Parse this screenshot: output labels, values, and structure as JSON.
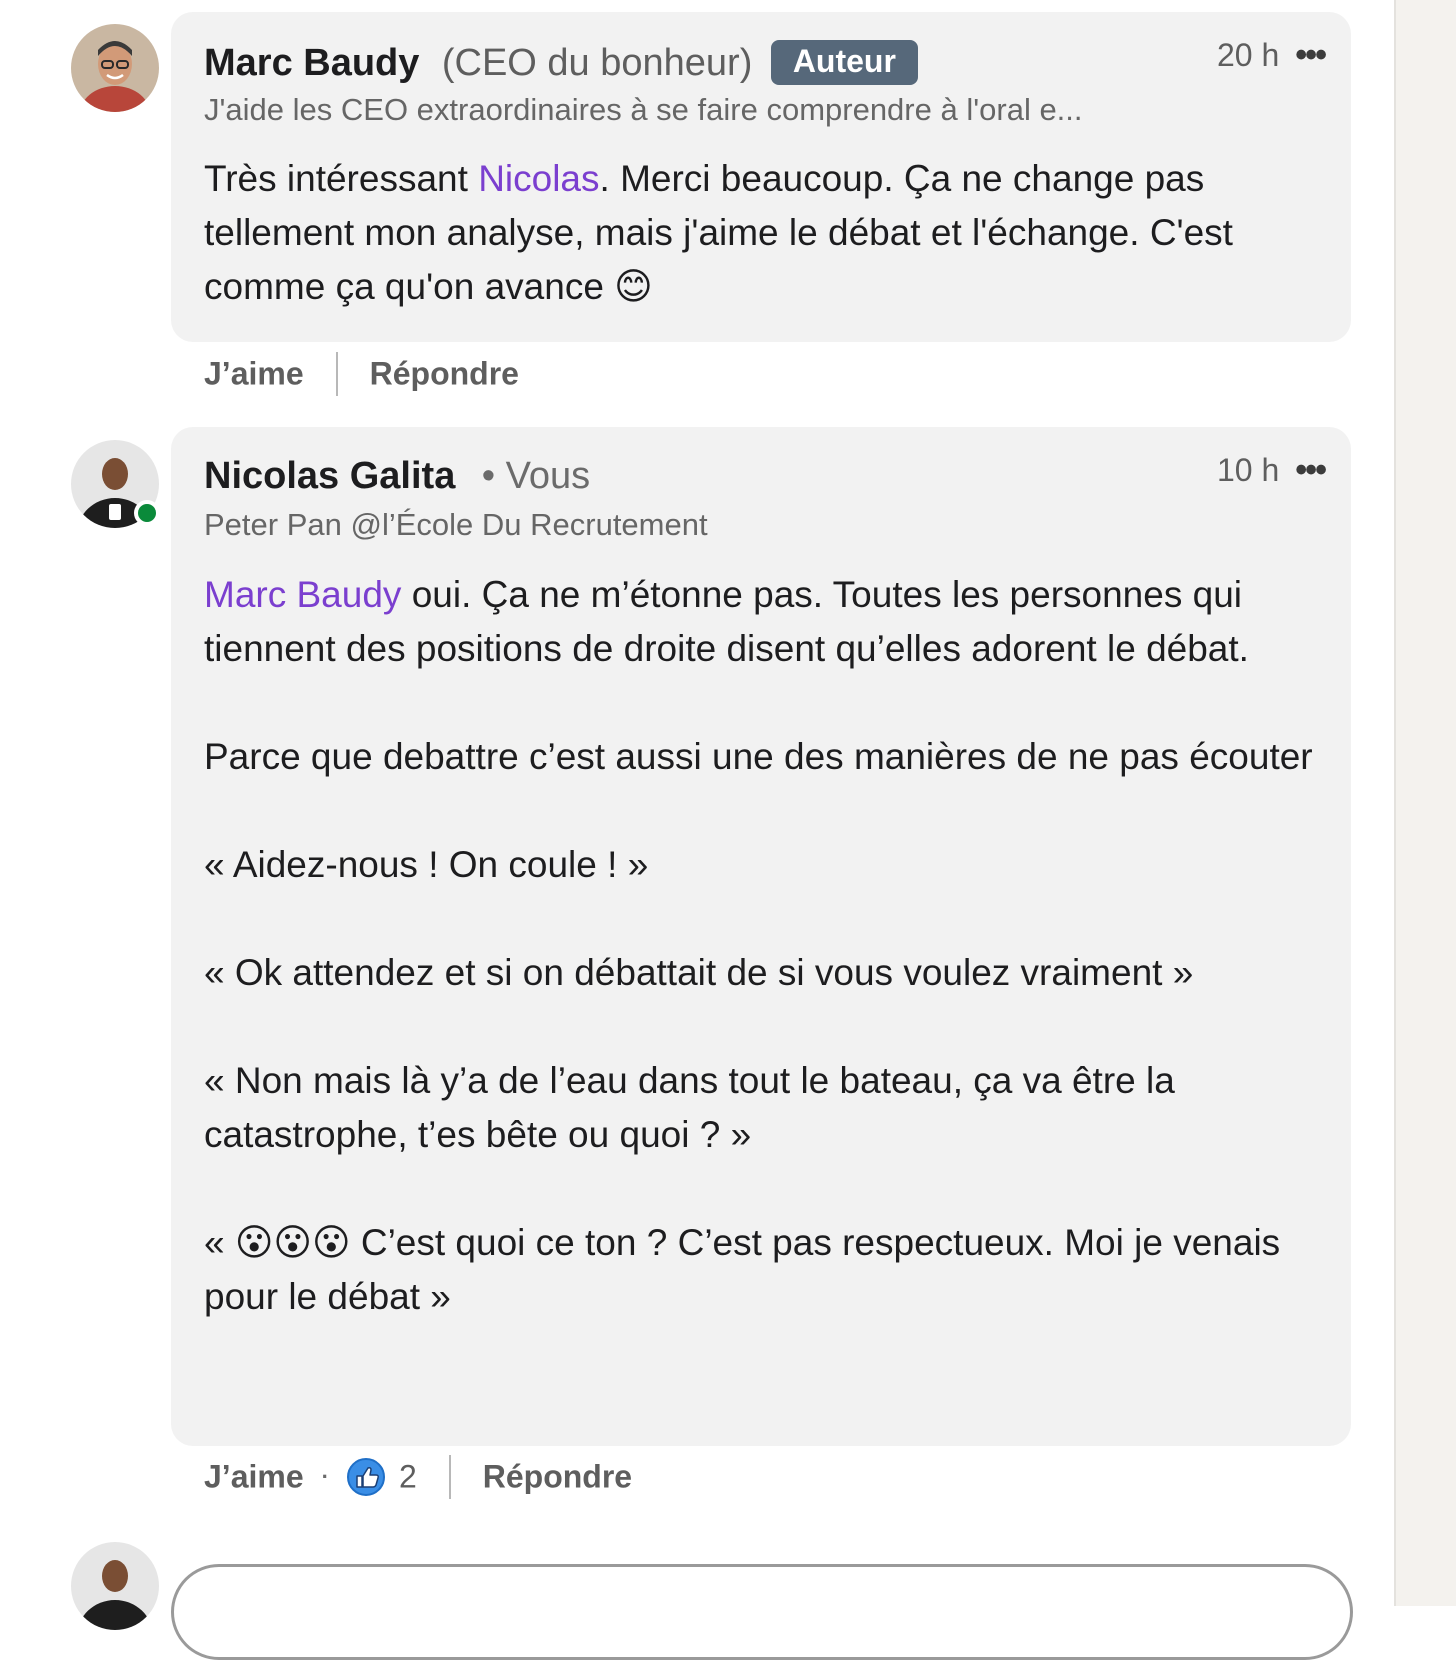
{
  "comments": [
    {
      "author": "Marc Baudy",
      "author_note": "(CEO du bonheur)",
      "badge": "Auteur",
      "time": "20 h",
      "headline": "J'aide les CEO extraordinaires à se faire comprendre à l'oral e...",
      "body_mention": "Nicolas",
      "body_before": "Très intéressant ",
      "body_after": ". Merci beaucoup. Ça ne change pas tellement mon analyse, mais j'aime le débat et l'échange. C'est comme ça qu'on avance 😊",
      "like_label": "J’aime",
      "reply_label": "Répondre"
    },
    {
      "author": "Nicolas Galita",
      "you_label": "• Vous",
      "time": "10 h",
      "headline": "Peter Pan @l’École Du Recrutement",
      "body_mention": "Marc Baudy",
      "body_after": " oui. Ça ne m’étonne pas. Toutes les personnes qui tiennent des positions de droite disent qu’elles adorent le débat.\n\nParce que debattre c’est aussi une des manières de ne pas écouter\n\n« Aidez-nous ! On coule ! »\n\n« Ok attendez et si on débattait de si vous voulez vraiment »\n\n« Non mais là y’a de l’eau dans tout le bateau, ça va être la catastrophe, t’es bête ou quoi ? »\n\n« 😮😮😮 C’est quoi ce ton ? C’est pas respectueux. Moi je venais pour le débat »",
      "like_label": "J’aime",
      "like_count": "2",
      "reply_label": "Répondre"
    }
  ],
  "icons": {
    "more": "more-options-icon",
    "like": "like-reaction-icon"
  },
  "colors": {
    "mention": "#7b3fcf",
    "badge": "#56687a",
    "bubble": "#f2f2f2",
    "online": "#0a8a3a"
  }
}
